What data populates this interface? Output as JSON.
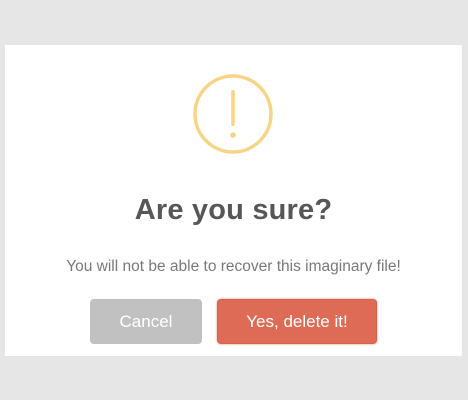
{
  "dialog": {
    "icon": "warning-exclamation-icon",
    "title": "Are you sure?",
    "message": "You will not be able to recover this imaginary file!",
    "buttons": {
      "cancel_label": "Cancel",
      "confirm_label": "Yes, delete it!"
    }
  },
  "colors": {
    "warning": "#f8d486",
    "confirm": "#dd6b55",
    "cancel": "#c1c1c1",
    "title": "#575757",
    "message": "#797979"
  }
}
